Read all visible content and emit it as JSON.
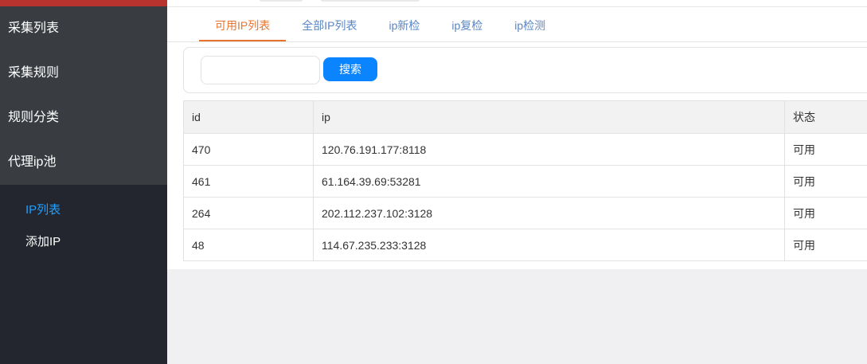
{
  "sidebar": {
    "groups": [
      {
        "label": "采集列表"
      },
      {
        "label": "采集规则"
      },
      {
        "label": "规则分类"
      },
      {
        "label": "代理ip池"
      }
    ],
    "sub_items": [
      {
        "label": "IP列表",
        "active": true
      },
      {
        "label": "添加IP",
        "active": false
      }
    ]
  },
  "tabs": [
    {
      "label": "可用IP列表",
      "active": true
    },
    {
      "label": "全部IP列表",
      "active": false
    },
    {
      "label": "ip新检",
      "active": false
    },
    {
      "label": "ip复检",
      "active": false
    },
    {
      "label": "ip检测",
      "active": false
    }
  ],
  "search": {
    "value": "",
    "placeholder": "",
    "button_label": "搜索"
  },
  "table": {
    "headers": [
      "id",
      "ip",
      "状态"
    ],
    "rows": [
      [
        "470",
        "120.76.191.177:8118",
        "可用"
      ],
      [
        "461",
        "61.164.39.69:53281",
        "可用"
      ],
      [
        "264",
        "202.112.237.102:3128",
        "可用"
      ],
      [
        "48",
        "114.67.235.233:3128",
        "可用"
      ]
    ]
  },
  "colors": {
    "sidebar_bg": "#23262e",
    "nav_group_bg": "#393d42",
    "accent_red": "#b8332e",
    "active_link": "#1e9fff",
    "tab_active": "#e8752d",
    "tab_link": "#5a86c4",
    "button_blue": "#0a84ff"
  }
}
